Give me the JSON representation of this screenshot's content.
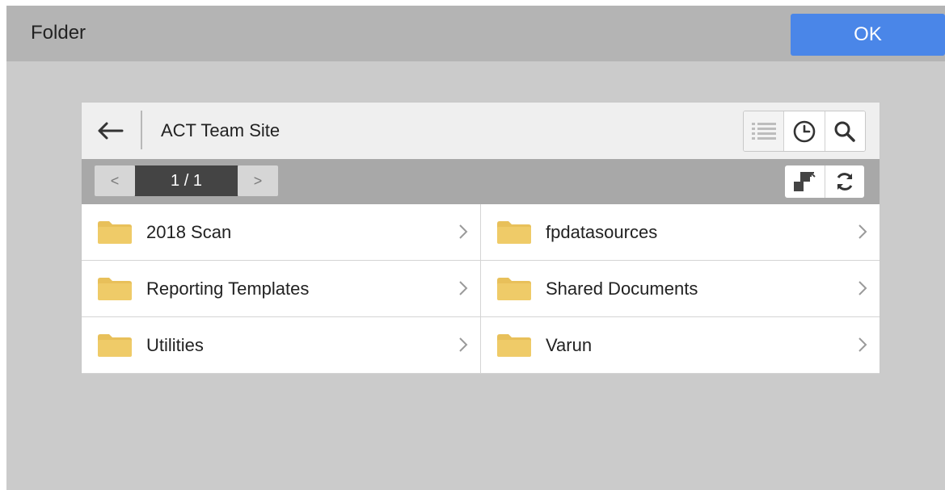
{
  "dialog": {
    "title": "Folder",
    "ok_label": "OK"
  },
  "browser": {
    "site_name": "ACT Team Site",
    "back_icon": "arrow-left-icon",
    "tools": [
      {
        "name": "list-view-icon"
      },
      {
        "name": "clock-icon"
      },
      {
        "name": "search-icon"
      }
    ],
    "pagination": {
      "prev_label": "<",
      "next_label": ">",
      "indicator": "1 / 1"
    },
    "actions": [
      {
        "name": "swap-icon"
      },
      {
        "name": "refresh-icon"
      }
    ],
    "folders": [
      {
        "label": "2018 Scan"
      },
      {
        "label": "fpdatasources"
      },
      {
        "label": "Reporting Templates"
      },
      {
        "label": "Shared Documents"
      },
      {
        "label": "Utilities"
      },
      {
        "label": "Varun"
      }
    ],
    "colors": {
      "folder": "#e8c05a",
      "accent": "#4a86e8"
    }
  }
}
